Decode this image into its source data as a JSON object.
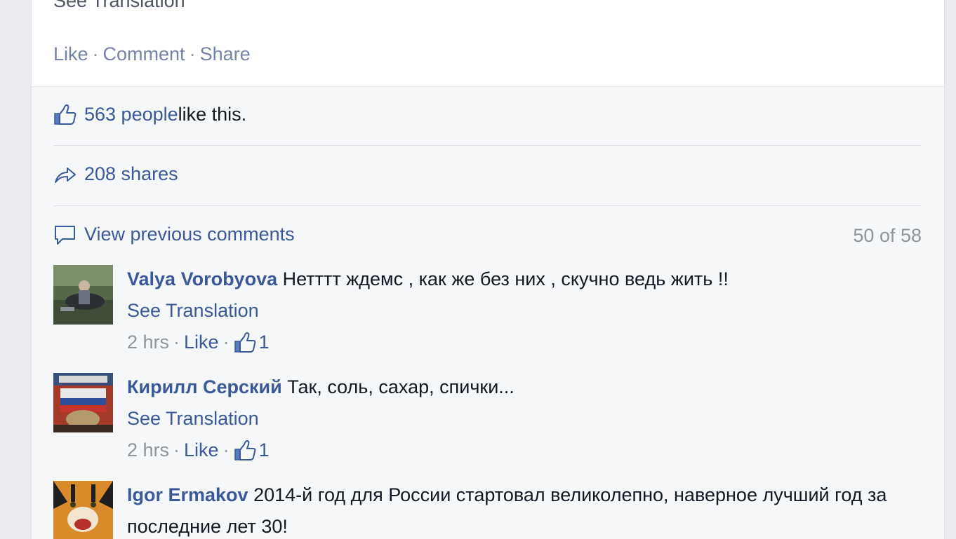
{
  "post": {
    "cut_text": "See Translation",
    "actions": {
      "like": "Like",
      "comment": "Comment",
      "share": "Share",
      "separator": "·"
    }
  },
  "likes": {
    "count_link": "563 people",
    "suffix": " like this."
  },
  "shares": {
    "label": "208 shares"
  },
  "comments_header": {
    "view_previous": "View previous comments",
    "count": "50 of 58"
  },
  "comments": [
    {
      "author": "Valya Vorobyova",
      "text": " Нетттт ждемс , как же без них , скучно ведь жить !!",
      "see_translation": "See Translation",
      "time": "2 hrs",
      "like": "Like",
      "likes": "1"
    },
    {
      "author": "Кирилл Серский",
      "text": " Так, соль, сахар, спички...",
      "see_translation": "See Translation",
      "time": "2 hrs",
      "like": "Like",
      "likes": "1"
    },
    {
      "author": "Igor Ermakov",
      "text": " 2014-й год для России стартовал великолепно, наверное лучший год за последние лет 30!"
    }
  ],
  "colors": {
    "link": "#3b5998",
    "muted": "#90949c",
    "text": "#141823",
    "background": "#f6f7f9"
  }
}
